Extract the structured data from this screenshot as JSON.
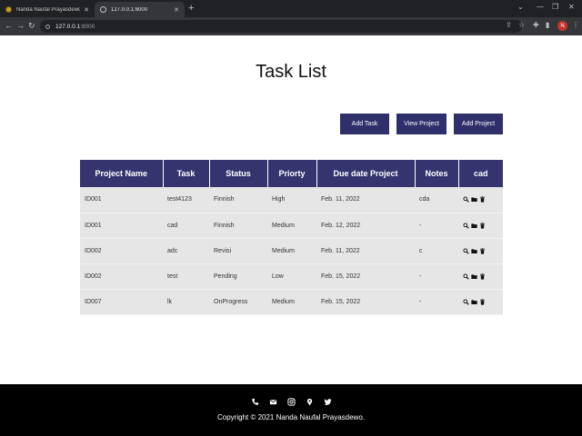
{
  "browser": {
    "tabs": [
      {
        "title": "Nanda Naufal Prayasdewo || CV",
        "active": false
      },
      {
        "title": "127.0.0.1:8000",
        "active": true
      }
    ],
    "address": {
      "host": "127.0.0.1",
      "port": ":8000"
    },
    "profile_initial": "N"
  },
  "page": {
    "title": "Task List",
    "buttons": {
      "add_task": "Add Task",
      "view_project": "View Project",
      "add_project": "Add Project"
    }
  },
  "table": {
    "headers": [
      "Project Name",
      "Task",
      "Status",
      "Priorty",
      "Due date Project",
      "Notes",
      "cad"
    ],
    "rows": [
      {
        "project": "ID001",
        "task": "test4123",
        "status": "Finnish",
        "priority": "High",
        "due": "Feb. 11, 2022",
        "notes": "cda"
      },
      {
        "project": "ID001",
        "task": "cad",
        "status": "Finnish",
        "priority": "Medium",
        "due": "Feb. 12, 2022",
        "notes": "-"
      },
      {
        "project": "ID002",
        "task": "adc",
        "status": "Revisi",
        "priority": "Medium",
        "due": "Feb. 11, 2022",
        "notes": "c"
      },
      {
        "project": "ID002",
        "task": "test",
        "status": "Pending",
        "priority": "Low",
        "due": "Feb. 15, 2022",
        "notes": "-"
      },
      {
        "project": "ID007",
        "task": "lk",
        "status": "OnProgress",
        "priority": "Medium",
        "due": "Feb. 15, 2022",
        "notes": "-"
      }
    ],
    "row_actions": [
      "view-icon",
      "folder-icon",
      "trash-icon"
    ]
  },
  "footer": {
    "social_icons": [
      "phone-icon",
      "email-icon",
      "instagram-icon",
      "location-icon",
      "twitter-icon"
    ],
    "copyright": "Copyright © 2021 Nanda Naufal Prayasdewo."
  },
  "colors": {
    "primary": "#35346f",
    "row_bg": "#e6e6e6",
    "footer_bg": "#000000"
  }
}
